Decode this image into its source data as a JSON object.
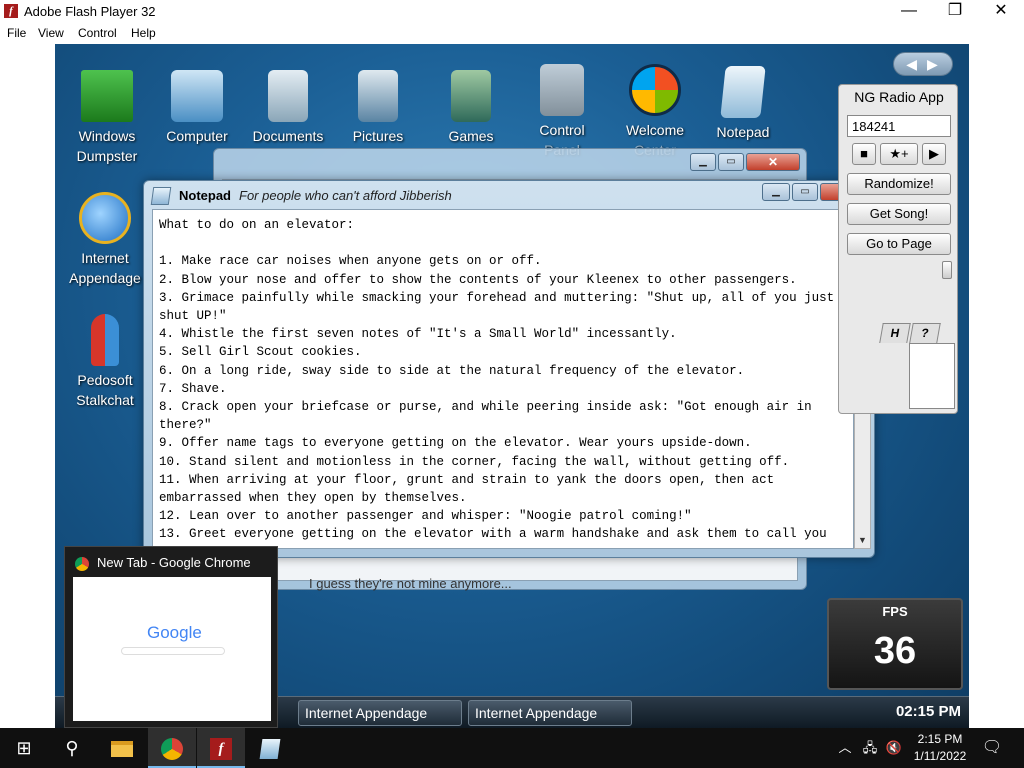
{
  "host": {
    "title": "Adobe Flash Player 32",
    "menu": [
      "File",
      "View",
      "Control",
      "Help"
    ]
  },
  "desktop_icons": [
    {
      "label_line1": "Windows",
      "label_line2": "Dumpster",
      "icon": "dumpster-icon"
    },
    {
      "label_line1": "Computer",
      "label_line2": "",
      "icon": "computer-icon"
    },
    {
      "label_line1": "Documents",
      "label_line2": "",
      "icon": "documents-icon"
    },
    {
      "label_line1": "Pictures",
      "label_line2": "",
      "icon": "pictures-icon"
    },
    {
      "label_line1": "Games",
      "label_line2": "",
      "icon": "games-icon"
    },
    {
      "label_line1": "Control",
      "label_line2": "Panel",
      "icon": "control-panel-icon"
    },
    {
      "label_line1": "Welcome",
      "label_line2": "Center",
      "icon": "windows-logo-icon"
    },
    {
      "label_line1": "Notepad",
      "label_line2": "",
      "icon": "notepad-icon"
    },
    {
      "label_line1": "Internet",
      "label_line2": "Appendage",
      "icon": "internet-explorer-icon"
    },
    {
      "label_line1": "Pedosoft",
      "label_line2": "Stalkchat",
      "icon": "messenger-icon"
    }
  ],
  "back_window": {
    "footer_text": "I guess they're not mine anymore..."
  },
  "notepad": {
    "title": "Notepad",
    "subtitle": "For people who can't afford Jibberish",
    "content": "What to do on an elevator:\n\n1. Make race car noises when anyone gets on or off.\n2. Blow your nose and offer to show the contents of your Kleenex to other passengers.\n3. Grimace painfully while smacking your forehead and muttering: \"Shut up, all of you just shut UP!\"\n4. Whistle the first seven notes of \"It's a Small World\" incessantly.\n5. Sell Girl Scout cookies.\n6. On a long ride, sway side to side at the natural frequency of the elevator.\n7. Shave.\n8. Crack open your briefcase or purse, and while peering inside ask: \"Got enough air in there?\"\n9. Offer name tags to everyone getting on the elevator. Wear yours upside-down.\n10. Stand silent and motionless in the corner, facing the wall, without getting off.\n11. When arriving at your floor, grunt and strain to yank the doors open, then act embarrassed when they open by themselves.\n12. Lean over to another passenger and whisper: \"Noogie patrol coming!\"\n13. Greet everyone getting on the elevator with a warm handshake and ask them to call you"
  },
  "radio": {
    "title": "NG Radio App",
    "input_value": "184241",
    "randomize": "Randomize!",
    "get_song": "Get Song!",
    "go_to_page": "Go to Page",
    "tab_h": "H",
    "tab_help": "?"
  },
  "fps": {
    "label": "FPS",
    "value": "36"
  },
  "inner_taskbar": {
    "buttons": [
      "Internet Appendage",
      "Internet Appendage"
    ],
    "clock": "02:15 PM"
  },
  "preview": {
    "title": "New Tab - Google Chrome",
    "google": "Google"
  },
  "windows_taskbar": {
    "time": "2:15 PM",
    "date": "1/11/2022"
  }
}
